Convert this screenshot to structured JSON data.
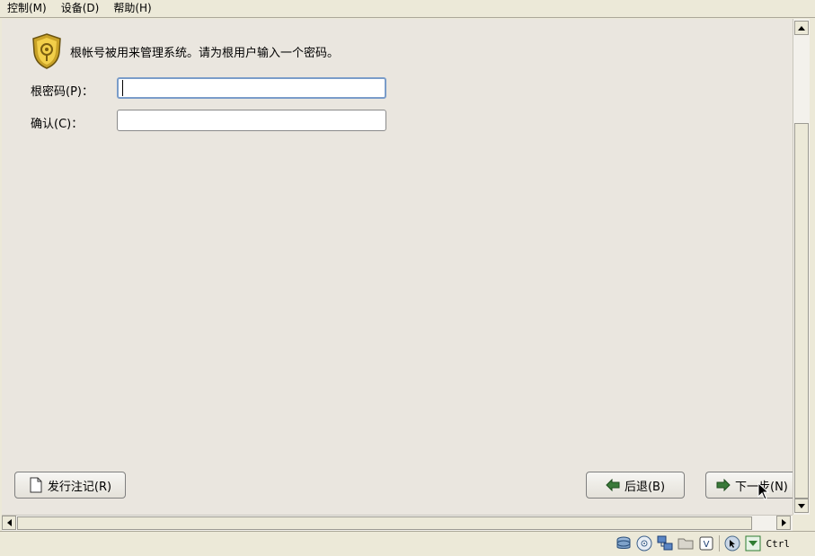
{
  "menu": {
    "items": [
      {
        "label": "控制(M)"
      },
      {
        "label": "设备(D)"
      },
      {
        "label": "帮助(H)"
      }
    ]
  },
  "page": {
    "header": "根帐号被用来管理系统。请为根用户输入一个密码。",
    "icon": "shield-key-icon"
  },
  "form": {
    "root_password_label": "根密码(P)：",
    "root_password_value": "",
    "confirm_label": "确认(C)：",
    "confirm_value": ""
  },
  "buttons": {
    "release_notes": "发行注记(R)",
    "back": "后退(B)",
    "next": "下一步(N)"
  },
  "statusbar": {
    "host_key": "Ctrl",
    "icons": [
      "hard-disk-icon",
      "cd-rom-icon",
      "network-icon",
      "shared-folder-icon",
      "usb-icon",
      "mouse-integration-icon",
      "seamless-icon"
    ]
  },
  "colors": {
    "background": "#ece9d8",
    "content": "#eae6df",
    "focus_border": "#7a9cc9",
    "accent_green": "#2e7d32"
  }
}
